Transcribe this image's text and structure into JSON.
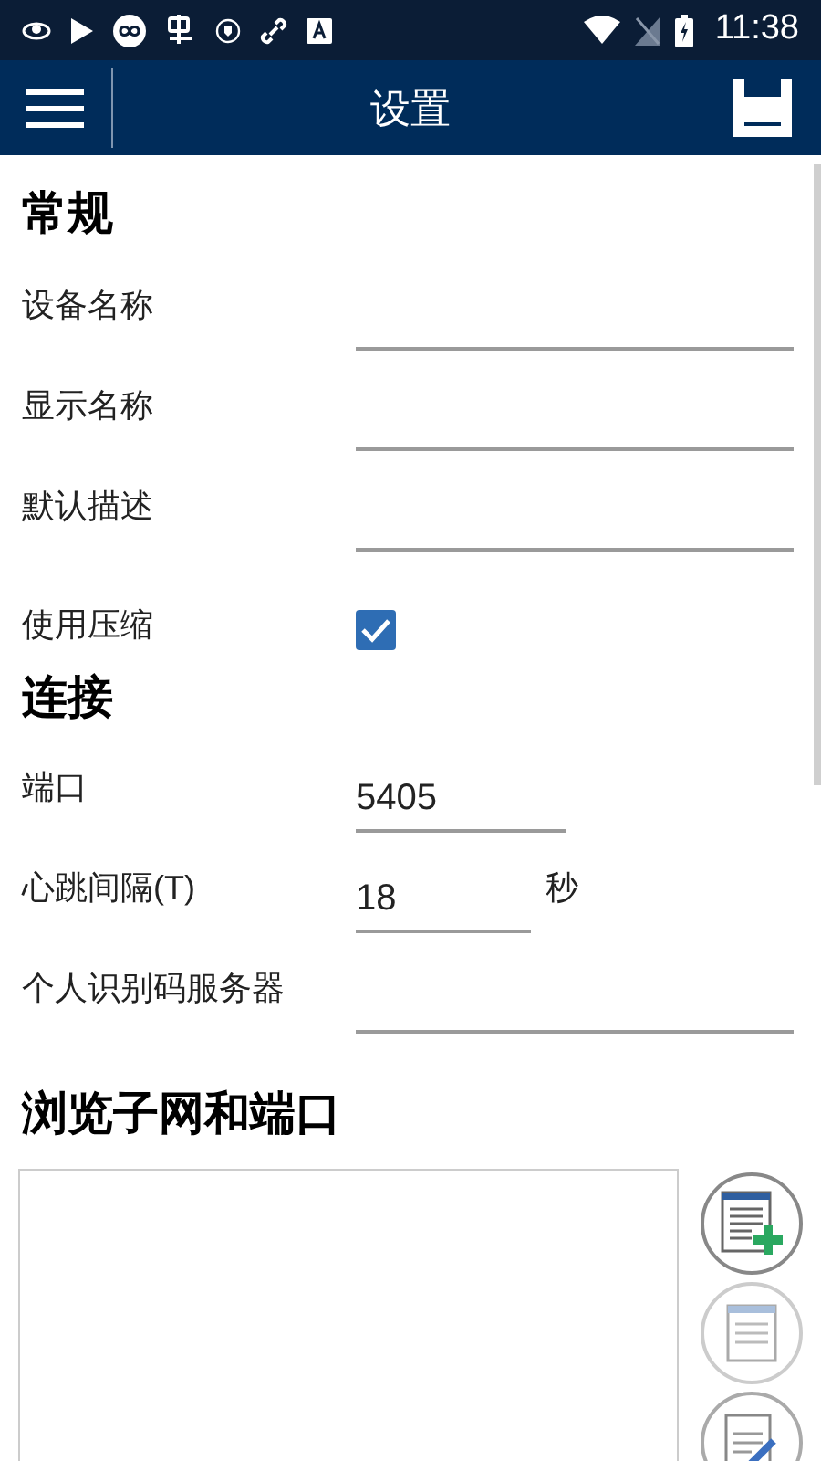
{
  "status_bar": {
    "time": "11:38"
  },
  "app_bar": {
    "title": "设置"
  },
  "sections": [
    {
      "title": "常规",
      "fields": [
        {
          "kind": "text",
          "label": "设备名称"
        },
        {
          "kind": "text",
          "label": "显示名称"
        },
        {
          "kind": "text",
          "label": "默认描述"
        },
        {
          "kind": "checkbox",
          "label": "使用压缩",
          "checked": true
        }
      ]
    },
    {
      "title": "连接",
      "fields": [
        {
          "kind": "number",
          "label": "端口",
          "value": "5405"
        },
        {
          "kind": "number",
          "label": "心跳间隔(T)",
          "value": "18",
          "unit": "秒"
        },
        {
          "kind": "text",
          "label": "个人识别码服务器"
        }
      ]
    },
    {
      "title": "浏览子网和端口",
      "fields": [
        {
          "kind": "list"
        }
      ]
    }
  ]
}
